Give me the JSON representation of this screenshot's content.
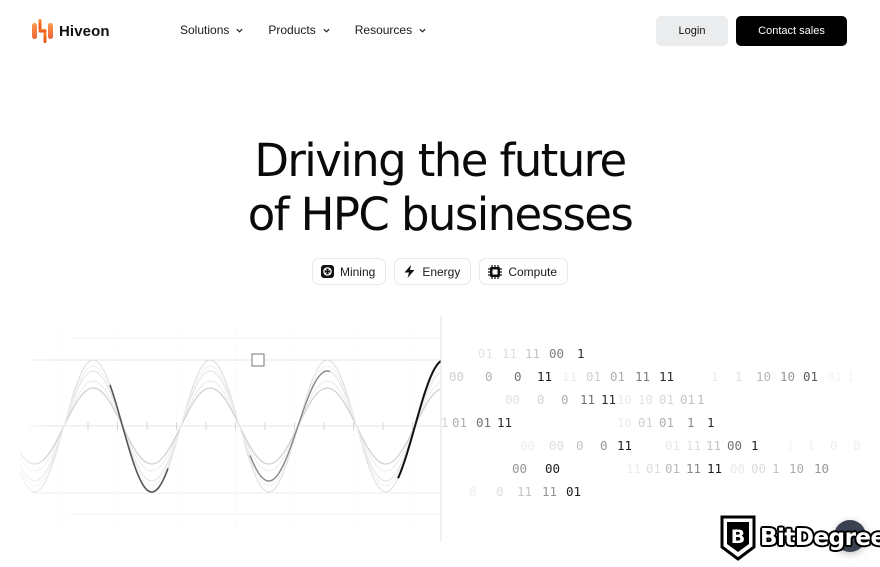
{
  "header": {
    "brand": "Hiveon",
    "brand_color": "#f26a1b",
    "nav": [
      {
        "label": "Solutions",
        "icon": "chevron-down-icon"
      },
      {
        "label": "Products",
        "icon": "chevron-down-icon"
      },
      {
        "label": "Resources",
        "icon": "chevron-down-icon"
      }
    ],
    "login_label": "Login",
    "contact_label": "Contact sales"
  },
  "hero": {
    "title_line1": "Driving the future",
    "title_line2": "of HPC businesses",
    "chips": [
      {
        "label": "Mining",
        "icon": "mining-icon"
      },
      {
        "label": "Energy",
        "icon": "lightning-bolt-icon"
      },
      {
        "label": "Compute",
        "icon": "chip-icon"
      }
    ]
  },
  "binary_rows": [
    [
      {
        "t": "01",
        "o": 0.12
      },
      {
        "t": "11",
        "o": 0.15
      },
      {
        "t": "11",
        "o": 0.25
      },
      {
        "t": "00",
        "o": 0.55
      },
      {
        "t": "1",
        "o": 0.9
      }
    ],
    [
      {
        "t": "00",
        "o": 0.2
      },
      {
        "t": "0",
        "o": 0.35
      },
      {
        "t": "0",
        "o": 0.6
      },
      {
        "t": "11",
        "o": 0.95
      },
      {
        "t": "11",
        "o": 0.08
      },
      {
        "t": "01",
        "o": 0.2
      },
      {
        "t": "01",
        "o": 0.35
      },
      {
        "t": "11",
        "o": 0.55
      },
      {
        "t": "11",
        "o": 0.9
      },
      {
        "t": "1",
        "o": 0.08
      },
      {
        "t": "1",
        "o": 0.12
      },
      {
        "t": "10",
        "o": 0.3
      },
      {
        "t": "10",
        "o": 0.45
      },
      {
        "t": "01",
        "o": 0.7
      },
      {
        "t": "01",
        "o": 0.05
      },
      {
        "t": "1",
        "o": 0.05
      }
    ],
    [
      {
        "t": "00",
        "o": 0.12
      },
      {
        "t": "0",
        "o": 0.18
      },
      {
        "t": "0",
        "o": 0.35
      },
      {
        "t": "11",
        "o": 0.6
      },
      {
        "t": "11",
        "o": 0.9
      },
      {
        "t": "10",
        "o": 0.08
      },
      {
        "t": "10",
        "o": 0.12
      },
      {
        "t": "01",
        "o": 0.18
      },
      {
        "t": "01",
        "o": 0.25
      },
      {
        "t": "1",
        "o": 0.3
      }
    ],
    [
      {
        "t": "1",
        "o": 0.2
      },
      {
        "t": "01",
        "o": 0.35
      },
      {
        "t": "01",
        "o": 0.6
      },
      {
        "t": "11",
        "o": 0.9
      },
      {
        "t": "10",
        "o": 0.08
      },
      {
        "t": "01",
        "o": 0.2
      },
      {
        "t": "01",
        "o": 0.35
      },
      {
        "t": "1",
        "o": 0.5
      },
      {
        "t": "1",
        "o": 0.9
      }
    ],
    [
      {
        "t": "00",
        "o": 0.08
      },
      {
        "t": "00",
        "o": 0.15
      },
      {
        "t": "0",
        "o": 0.25
      },
      {
        "t": "0",
        "o": 0.45
      },
      {
        "t": "11",
        "o": 0.95
      },
      {
        "t": "01",
        "o": 0.1
      },
      {
        "t": "11",
        "o": 0.15
      },
      {
        "t": "11",
        "o": 0.25
      },
      {
        "t": "00",
        "o": 0.6
      },
      {
        "t": "1",
        "o": 0.95
      },
      {
        "t": "1",
        "o": 0.05
      },
      {
        "t": "1",
        "o": 0.06
      },
      {
        "t": "0",
        "o": 0.08
      },
      {
        "t": "0",
        "o": 0.08
      }
    ],
    [
      {
        "t": "00",
        "o": 0.45
      },
      {
        "t": "00",
        "o": 0.95
      },
      {
        "t": "11",
        "o": 0.08
      },
      {
        "t": "01",
        "o": 0.15
      },
      {
        "t": "01",
        "o": 0.3
      },
      {
        "t": "11",
        "o": 0.5
      },
      {
        "t": "11",
        "o": 0.95
      },
      {
        "t": "00",
        "o": 0.1
      },
      {
        "t": "00",
        "o": 0.15
      },
      {
        "t": "1",
        "o": 0.25
      },
      {
        "t": "10",
        "o": 0.35
      },
      {
        "t": "10",
        "o": 0.45
      }
    ],
    [
      {
        "t": "0",
        "o": 0.08
      },
      {
        "t": "0",
        "o": 0.15
      },
      {
        "t": "11",
        "o": 0.25
      },
      {
        "t": "11",
        "o": 0.45
      },
      {
        "t": "01",
        "o": 0.95
      }
    ]
  ],
  "badge": {
    "text": "BitDegree",
    "icon": "bitdegree-shield-icon"
  },
  "chat": {
    "icon": "chat-icon"
  }
}
